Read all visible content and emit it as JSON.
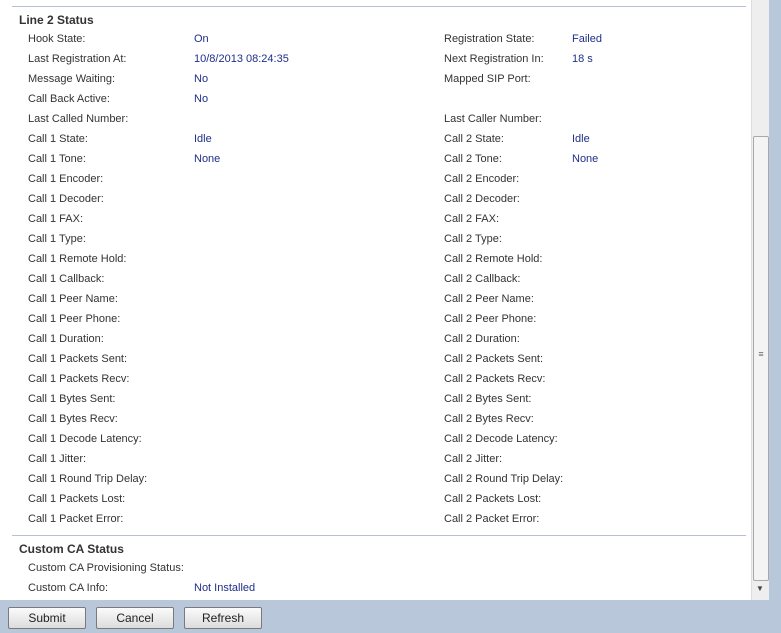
{
  "line2": {
    "title": "Line 2 Status",
    "rows": [
      {
        "l": "Hook State:",
        "lv": "On",
        "r": "Registration State:",
        "rv": "Failed"
      },
      {
        "l": "Last Registration At:",
        "lv": "10/8/2013 08:24:35",
        "r": "Next Registration In:",
        "rv": "18 s"
      },
      {
        "l": "Message Waiting:",
        "lv": "No",
        "r": "Mapped SIP Port:",
        "rv": ""
      },
      {
        "l": "Call Back Active:",
        "lv": "No",
        "r": "",
        "rv": ""
      },
      {
        "l": "Last Called Number:",
        "lv": "",
        "r": "Last Caller Number:",
        "rv": ""
      },
      {
        "l": "Call 1 State:",
        "lv": "Idle",
        "r": "Call 2 State:",
        "rv": "Idle"
      },
      {
        "l": "Call 1 Tone:",
        "lv": "None",
        "r": "Call 2 Tone:",
        "rv": "None"
      },
      {
        "l": "Call 1 Encoder:",
        "lv": "",
        "r": "Call 2 Encoder:",
        "rv": ""
      },
      {
        "l": "Call 1 Decoder:",
        "lv": "",
        "r": "Call 2 Decoder:",
        "rv": ""
      },
      {
        "l": "Call 1 FAX:",
        "lv": "",
        "r": "Call 2 FAX:",
        "rv": ""
      },
      {
        "l": "Call 1 Type:",
        "lv": "",
        "r": "Call 2 Type:",
        "rv": ""
      },
      {
        "l": "Call 1 Remote Hold:",
        "lv": "",
        "r": "Call 2 Remote Hold:",
        "rv": ""
      },
      {
        "l": "Call 1 Callback:",
        "lv": "",
        "r": "Call 2 Callback:",
        "rv": ""
      },
      {
        "l": "Call 1 Peer Name:",
        "lv": "",
        "r": "Call 2 Peer Name:",
        "rv": ""
      },
      {
        "l": "Call 1 Peer Phone:",
        "lv": "",
        "r": "Call 2 Peer Phone:",
        "rv": ""
      },
      {
        "l": "Call 1 Duration:",
        "lv": "",
        "r": "Call 2 Duration:",
        "rv": ""
      },
      {
        "l": "Call 1 Packets Sent:",
        "lv": "",
        "r": "Call 2 Packets Sent:",
        "rv": ""
      },
      {
        "l": "Call 1 Packets Recv:",
        "lv": "",
        "r": "Call 2 Packets Recv:",
        "rv": ""
      },
      {
        "l": "Call 1 Bytes Sent:",
        "lv": "",
        "r": "Call 2 Bytes Sent:",
        "rv": ""
      },
      {
        "l": "Call 1 Bytes Recv:",
        "lv": "",
        "r": "Call 2 Bytes Recv:",
        "rv": ""
      },
      {
        "l": "Call 1 Decode Latency:",
        "lv": "",
        "r": "Call 2 Decode Latency:",
        "rv": ""
      },
      {
        "l": "Call 1 Jitter:",
        "lv": "",
        "r": "Call 2 Jitter:",
        "rv": ""
      },
      {
        "l": "Call 1 Round Trip Delay:",
        "lv": "",
        "r": "Call 2 Round Trip Delay:",
        "rv": ""
      },
      {
        "l": "Call 1 Packets Lost:",
        "lv": "",
        "r": "Call 2 Packets Lost:",
        "rv": ""
      },
      {
        "l": "Call 1 Packet Error:",
        "lv": "",
        "r": "Call 2 Packet Error:",
        "rv": ""
      }
    ]
  },
  "custom_ca": {
    "title": "Custom CA Status",
    "rows": [
      {
        "l": "Custom CA Provisioning Status:",
        "lv": "",
        "r": "",
        "rv": ""
      },
      {
        "l": "Custom CA Info:",
        "lv": "Not Installed",
        "r": "",
        "rv": ""
      }
    ]
  },
  "buttons": {
    "submit": "Submit",
    "cancel": "Cancel",
    "refresh": "Refresh"
  },
  "scrollbar": {
    "grip_icon": "grip-lines-icon",
    "down_icon": "arrow-down-icon"
  },
  "colors": {
    "value_text": "#1f2f8a",
    "label_text": "#333333",
    "frame_background": "#b9c7da"
  }
}
